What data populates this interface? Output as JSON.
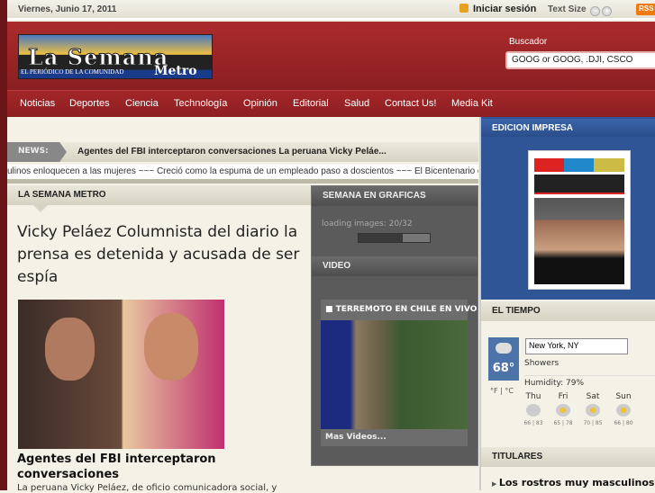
{
  "topbar": {
    "date": "Viernes, Junio 17, 2011",
    "login": "Iniciar sesión",
    "text_size": "Text Size",
    "minus": "−",
    "plus": "+",
    "rss": "RSS"
  },
  "header": {
    "logo_title": "La Semana",
    "logo_subtitle": "EL PERIÓDICO DE LA COMUNIDAD",
    "logo_metro": "Metro",
    "search_label": "Buscador",
    "search_value": "GOOG or GOOG, .DJI, CSCO"
  },
  "nav": [
    "Noticias",
    "Deportes",
    "Ciencia",
    "Technología",
    "Opinión",
    "Editorial",
    "Salud",
    "Contact Us!",
    "Media Kit"
  ],
  "news": {
    "label": "NEWS:",
    "headline": "Agentes del FBI interceptaron conversaciones La peruana Vicky Peláe...",
    "ticker": "ulinos enloquecen a las mujeres ~~~ Creció como la espuma de un empleado paso a doscientos ~~~ El Bicentenario de independencia"
  },
  "main": {
    "section": "LA SEMANA METRO",
    "headline": "Vicky Peláez Columnista del diario la prensa es detenida y acusada de ser espía",
    "caption": "Agentes del FBI interceptaron conversaciones",
    "desc": "La peruana Vicky Peláez, de oficio comunicadora social, y"
  },
  "graficas": {
    "title": "SEMANA EN GRAFICAS",
    "loading": "loading images: 20/32",
    "progress": 0.625
  },
  "video": {
    "title": "VIDEO",
    "item": "TERREMOTO EN CHILE EN VIVO",
    "more": "Mas Videos..."
  },
  "sidebar": {
    "edicion": "EDICION IMPRESA",
    "tiempo": "EL TIEMPO",
    "titulares": "TITULARES",
    "titular1": "Los rostros muy masculinos"
  },
  "weather": {
    "temp": "68°",
    "city": "New York, NY",
    "condition": "Showers",
    "humidity": "Humidity: 79%",
    "units": "°F | °C",
    "days": [
      {
        "d": "Thu",
        "t": "66 | 83"
      },
      {
        "d": "Fri",
        "t": "65 | 78"
      },
      {
        "d": "Sat",
        "t": "70 | 85"
      },
      {
        "d": "Sun",
        "t": "66 | 80"
      }
    ]
  },
  "colors": {
    "brand_red": "#9c2427",
    "edition_blue": "#2f5597"
  }
}
